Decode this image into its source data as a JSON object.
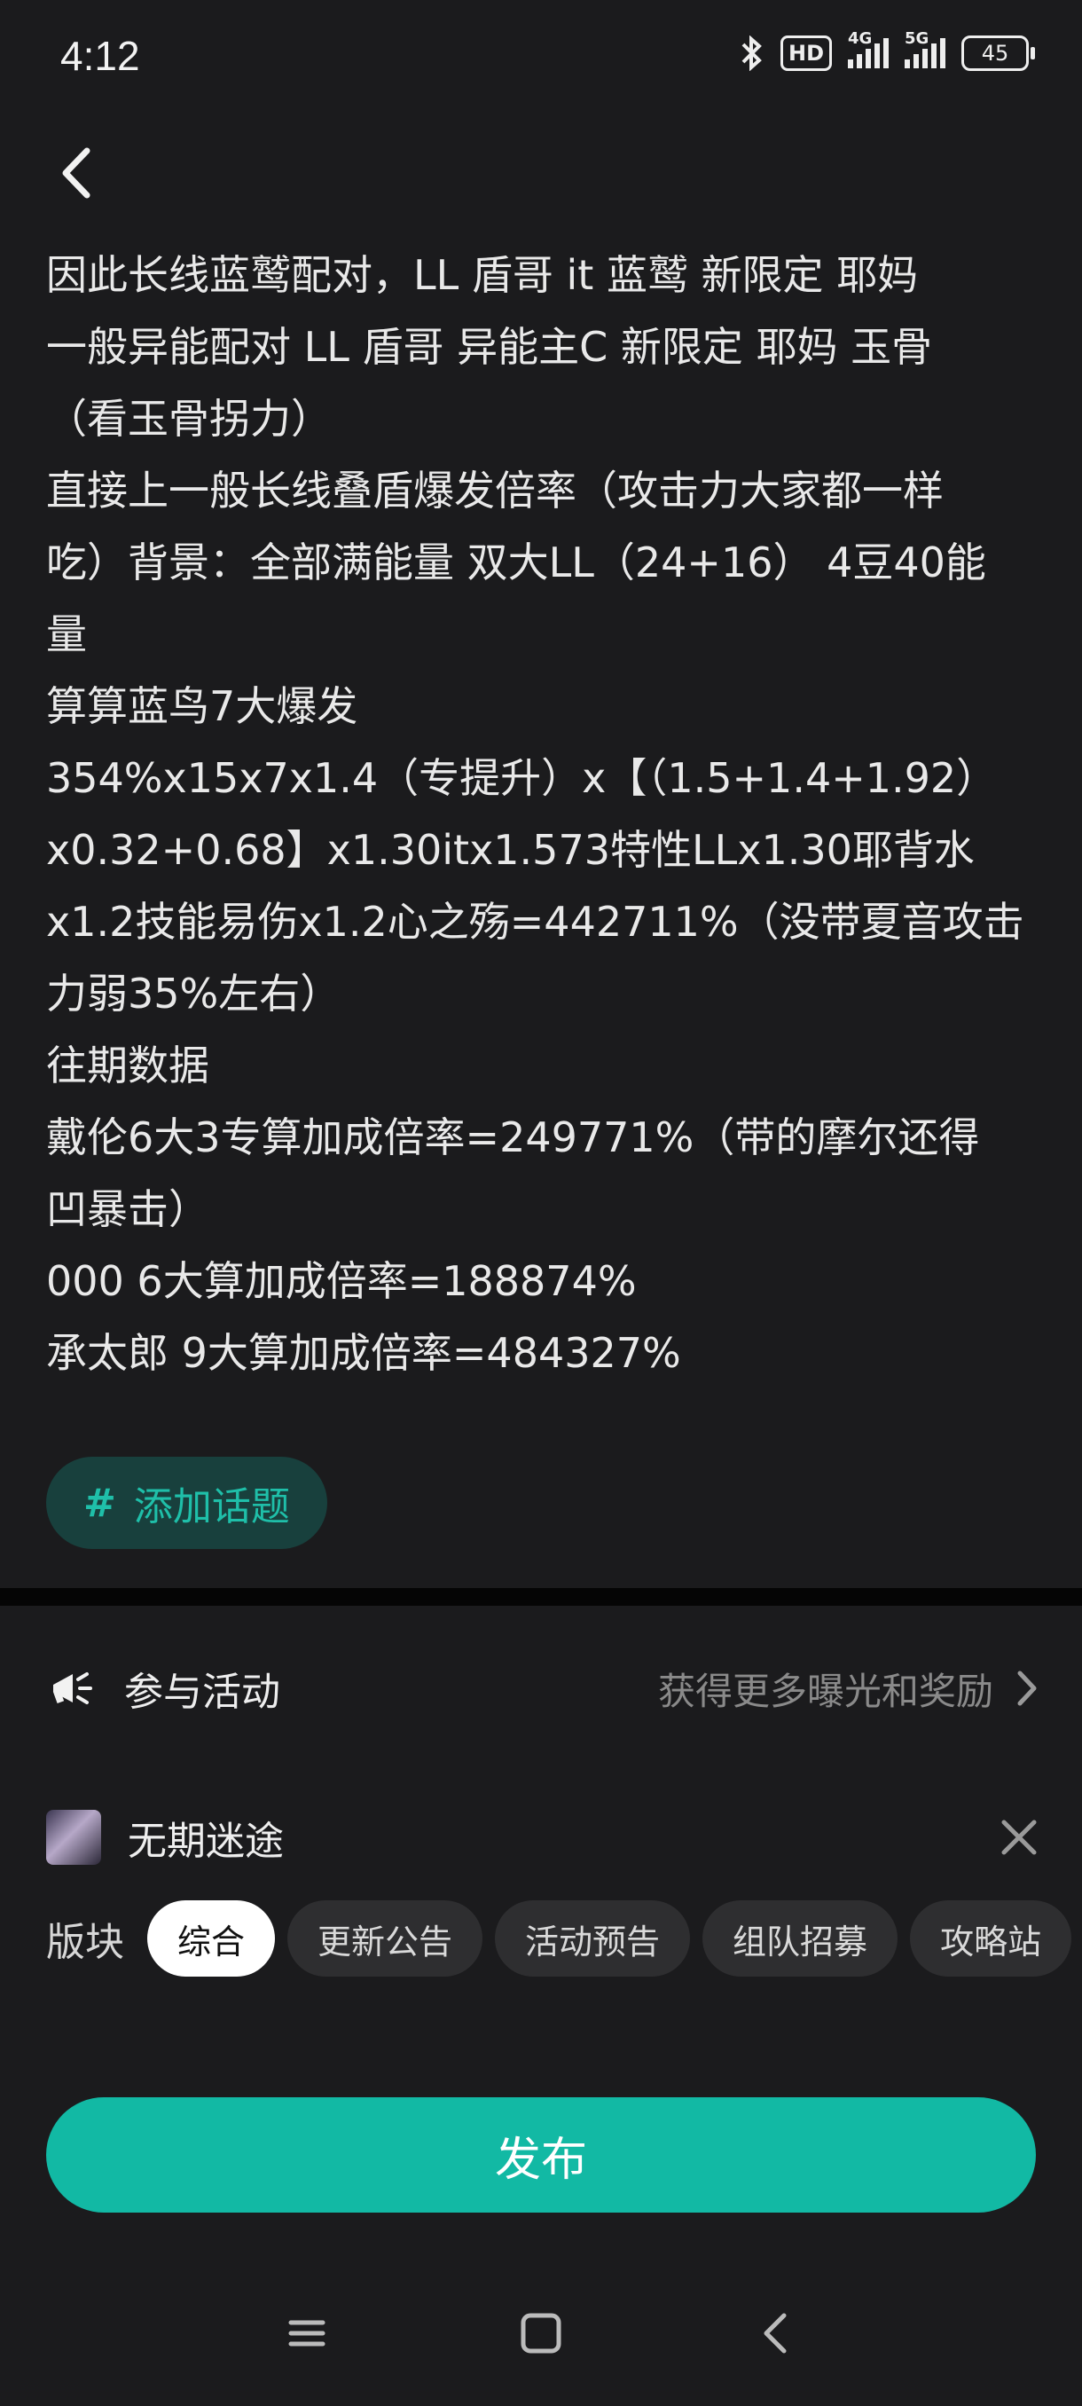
{
  "status_bar": {
    "time": "4:12",
    "hd_label": "HD",
    "net1_label": "4G",
    "net2_label": "5G",
    "battery": "45"
  },
  "post_text": [
    "因此长线蓝鹫配对，LL 盾哥 it 蓝鹫 新限定 耶妈",
    "一般异能配对 LL 盾哥 异能主C 新限定 耶妈 玉骨",
    "（看玉骨拐力）",
    "直接上一般长线叠盾爆发倍率（攻击力大家都一样",
    "吃）背景：全部满能量 双大LL（24+16） 4豆40能",
    "量",
    "算算蓝鸟7大爆发",
    "354%x15x7x1.4（专提升）x【（1.5+1.4+1.92）",
    "x0.32+0.68】x1.30itx1.573特性LLx1.30耶背水",
    "x1.2技能易伤x1.2心之殇=442711%（没带夏音攻击",
    "力弱35%左右）",
    "往期数据",
    "戴伦6大3专算加成倍率=249771%（带的摩尔还得",
    "凹暴击）",
    "000 6大算加成倍率=188874%",
    "承太郎 9大算加成倍率=484327%"
  ],
  "topic": {
    "hash": "#",
    "label": "添加话题"
  },
  "activity": {
    "label": "参与活动",
    "hint": "获得更多曝光和奖励"
  },
  "user": {
    "name": "无期迷途"
  },
  "board": {
    "label": "版块",
    "chips": [
      "综合",
      "更新公告",
      "活动预告",
      "组队招募",
      "攻略站"
    ],
    "selected": "综合"
  },
  "publish_label": "发布",
  "colors": {
    "accent": "#12b9a4",
    "background": "#1b1b1d"
  }
}
